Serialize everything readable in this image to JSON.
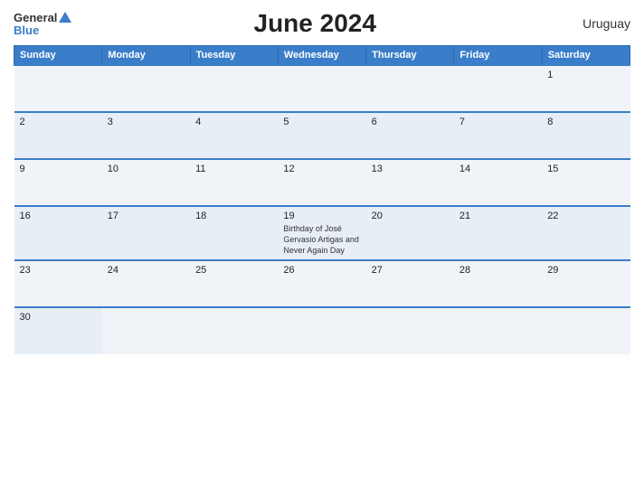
{
  "header": {
    "title": "June 2024",
    "country": "Uruguay",
    "logo": {
      "general": "General",
      "blue": "Blue"
    }
  },
  "weekdays": [
    "Sunday",
    "Monday",
    "Tuesday",
    "Wednesday",
    "Thursday",
    "Friday",
    "Saturday"
  ],
  "weeks": [
    [
      {
        "day": "",
        "empty": true
      },
      {
        "day": "",
        "empty": true
      },
      {
        "day": "",
        "empty": true
      },
      {
        "day": "",
        "empty": true
      },
      {
        "day": "",
        "empty": true
      },
      {
        "day": "",
        "empty": true
      },
      {
        "day": "1",
        "empty": false,
        "event": ""
      }
    ],
    [
      {
        "day": "2",
        "empty": false,
        "event": ""
      },
      {
        "day": "3",
        "empty": false,
        "event": ""
      },
      {
        "day": "4",
        "empty": false,
        "event": ""
      },
      {
        "day": "5",
        "empty": false,
        "event": ""
      },
      {
        "day": "6",
        "empty": false,
        "event": ""
      },
      {
        "day": "7",
        "empty": false,
        "event": ""
      },
      {
        "day": "8",
        "empty": false,
        "event": ""
      }
    ],
    [
      {
        "day": "9",
        "empty": false,
        "event": ""
      },
      {
        "day": "10",
        "empty": false,
        "event": ""
      },
      {
        "day": "11",
        "empty": false,
        "event": ""
      },
      {
        "day": "12",
        "empty": false,
        "event": ""
      },
      {
        "day": "13",
        "empty": false,
        "event": ""
      },
      {
        "day": "14",
        "empty": false,
        "event": ""
      },
      {
        "day": "15",
        "empty": false,
        "event": ""
      }
    ],
    [
      {
        "day": "16",
        "empty": false,
        "event": ""
      },
      {
        "day": "17",
        "empty": false,
        "event": ""
      },
      {
        "day": "18",
        "empty": false,
        "event": ""
      },
      {
        "day": "19",
        "empty": false,
        "event": "Birthday of José Gervasio Artigas and Never Again Day"
      },
      {
        "day": "20",
        "empty": false,
        "event": ""
      },
      {
        "day": "21",
        "empty": false,
        "event": ""
      },
      {
        "day": "22",
        "empty": false,
        "event": ""
      }
    ],
    [
      {
        "day": "23",
        "empty": false,
        "event": ""
      },
      {
        "day": "24",
        "empty": false,
        "event": ""
      },
      {
        "day": "25",
        "empty": false,
        "event": ""
      },
      {
        "day": "26",
        "empty": false,
        "event": ""
      },
      {
        "day": "27",
        "empty": false,
        "event": ""
      },
      {
        "day": "28",
        "empty": false,
        "event": ""
      },
      {
        "day": "29",
        "empty": false,
        "event": ""
      }
    ],
    [
      {
        "day": "30",
        "empty": false,
        "event": ""
      },
      {
        "day": "",
        "empty": true
      },
      {
        "day": "",
        "empty": true
      },
      {
        "day": "",
        "empty": true
      },
      {
        "day": "",
        "empty": true
      },
      {
        "day": "",
        "empty": true
      },
      {
        "day": "",
        "empty": true
      }
    ]
  ],
  "colors": {
    "header_bg": "#3a7dc9",
    "row_alt1": "#f0f4f8",
    "row_alt2": "#e8eef5",
    "border_top": "#3a7dc9"
  }
}
